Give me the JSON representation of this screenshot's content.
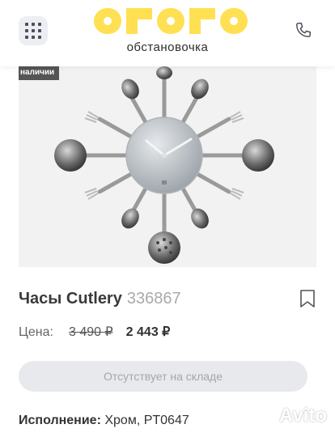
{
  "header": {
    "logo_text": "ОГОГО",
    "tagline": "обстановочка",
    "brand_color": "#FFE052"
  },
  "product": {
    "stock_badge": "наличии",
    "title": "Часы Cutlery",
    "sku": "336867",
    "price_label": "Цена:",
    "old_price": "3 490 ₽",
    "new_price": "2 443 ₽",
    "availability_button": "Отсутствует на складе",
    "spec_label": "Исполнение:",
    "spec_value": "Хром, PT0647"
  },
  "watermark": {
    "text": "Avito"
  }
}
